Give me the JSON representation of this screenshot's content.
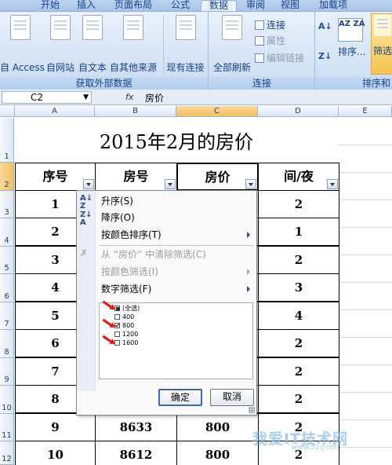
{
  "ribbon": {
    "tabs": [
      {
        "label": "开始",
        "active": false
      },
      {
        "label": "插入",
        "active": false
      },
      {
        "label": "页面布局",
        "active": false
      },
      {
        "label": "公式",
        "active": false
      },
      {
        "label": "数据",
        "active": true
      },
      {
        "label": "审阅",
        "active": false
      },
      {
        "label": "视图",
        "active": false
      },
      {
        "label": "加载项",
        "active": false
      }
    ],
    "groups": {
      "external": {
        "label": "获取外部数据",
        "buttons": [
          "自 Access",
          "自网站",
          "自文本",
          "自其他来源",
          "现有连接"
        ]
      },
      "connections": {
        "label": "连接",
        "refresh_all": "全部刷新",
        "connections": "连接",
        "properties": "属性",
        "edit_links": "编辑链接"
      },
      "sort": {
        "label": "排序和",
        "sort": "排序...",
        "filter": "筛选"
      }
    }
  },
  "formula_bar": {
    "name_box": "C2",
    "fx": "fx",
    "value": "房价"
  },
  "sheet": {
    "columns": [
      "A",
      "B",
      "C",
      "D",
      "E"
    ],
    "selected_column": "C",
    "rows": [
      "1",
      "2",
      "3",
      "4",
      "5",
      "6",
      "7",
      "8",
      "9",
      "10",
      "11",
      "12"
    ],
    "selected_row": "2",
    "title": "2015年2月的房价",
    "headers": [
      "序号",
      "房号",
      "房价",
      "间/夜"
    ],
    "data": [
      {
        "seq": "1",
        "room": "",
        "price": "",
        "nights": "2"
      },
      {
        "seq": "2",
        "room": "",
        "price": "",
        "nights": "1"
      },
      {
        "seq": "3",
        "room": "",
        "price": "",
        "nights": "2"
      },
      {
        "seq": "4",
        "room": "",
        "price": "",
        "nights": "3"
      },
      {
        "seq": "5",
        "room": "",
        "price": "",
        "nights": "4"
      },
      {
        "seq": "6",
        "room": "",
        "price": "",
        "nights": "2"
      },
      {
        "seq": "7",
        "room": "",
        "price": "",
        "nights": "2"
      },
      {
        "seq": "8",
        "room": "",
        "price": "",
        "nights": "2"
      },
      {
        "seq": "9",
        "room": "8633",
        "price": "800",
        "nights": "2"
      },
      {
        "seq": "10",
        "room": "8612",
        "price": "800",
        "nights": "2"
      }
    ]
  },
  "filter_menu": {
    "sort_asc": "升序(S)",
    "sort_desc": "降序(O)",
    "sort_by_color": "按颜色排序(T)",
    "clear_filter": "从 “房价” 中清除筛选(C)",
    "filter_by_color": "按颜色筛选(I)",
    "number_filters": "数字筛选(F)",
    "values": [
      {
        "label": "(全选)",
        "state": "partial"
      },
      {
        "label": "400",
        "state": "unchecked"
      },
      {
        "label": "800",
        "state": "checked"
      },
      {
        "label": "1200",
        "state": "unchecked"
      },
      {
        "label": "1600",
        "state": "unchecked"
      }
    ],
    "ok": "确定",
    "cancel": "取消"
  },
  "watermark": {
    "main": "我爱IT技术网",
    "sub": "www.52ij.com"
  }
}
